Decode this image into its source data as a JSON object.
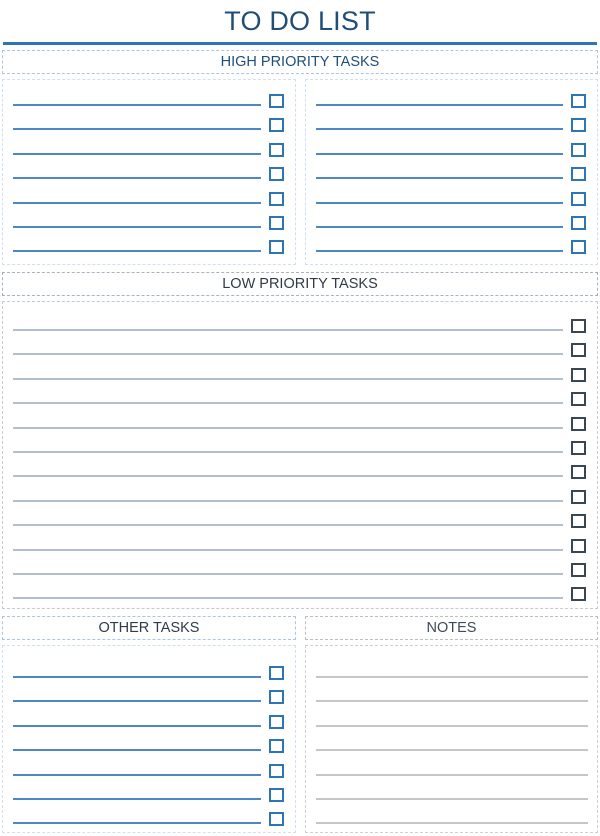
{
  "title": "TO DO LIST",
  "sections": {
    "high_priority": {
      "header": "HIGH PRIORITY TASKS",
      "columns": 2,
      "rows_per_column": 7,
      "accent": "#2e75b6"
    },
    "low_priority": {
      "header": "LOW PRIORITY TASKS",
      "rows": 12,
      "accent": "#3b4653"
    },
    "other_tasks": {
      "header": "OTHER TASKS",
      "rows": 7,
      "accent": "#2e75b6"
    },
    "notes": {
      "header": "NOTES",
      "lines": 7,
      "accent": "#c6c6c6"
    }
  }
}
